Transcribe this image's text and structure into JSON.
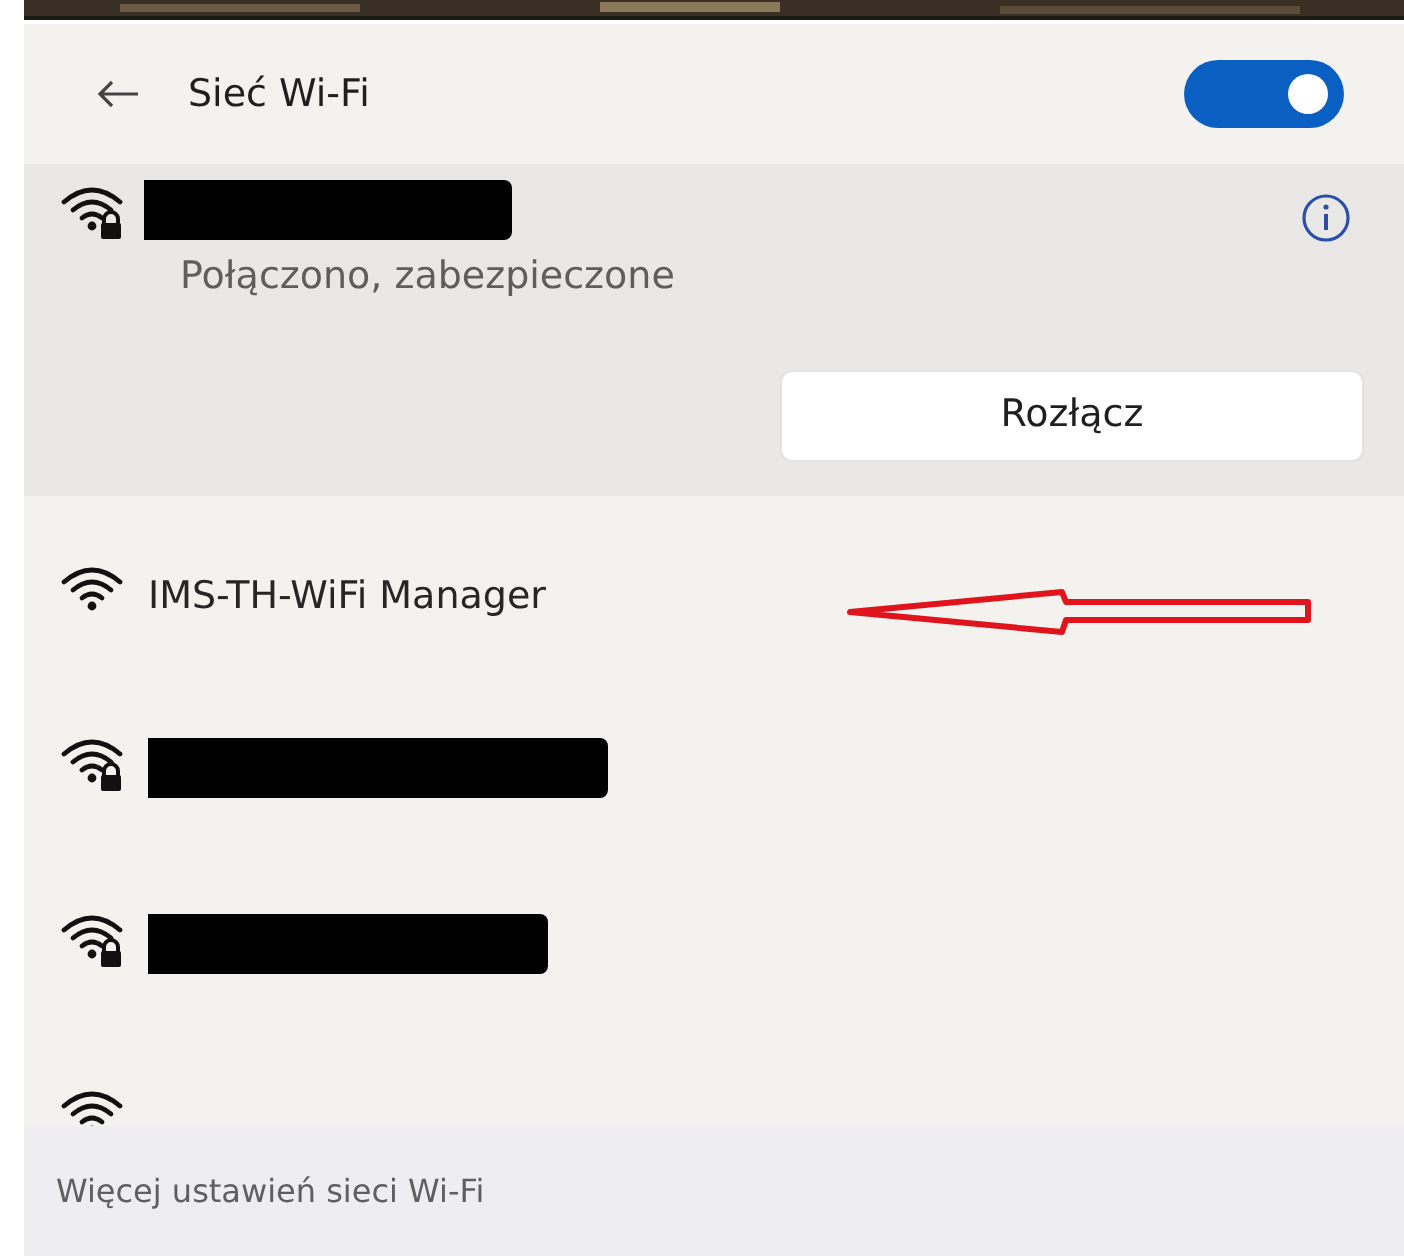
{
  "header": {
    "title": "Sieć Wi-Fi",
    "wifi_on": true
  },
  "connected": {
    "kind": "redacted",
    "status": "Połączono, zabezpieczone",
    "secured": true,
    "button": "Rozłącz"
  },
  "networks": [
    {
      "kind": "named",
      "name": "IMS-TH-WiFi Manager",
      "secured": false,
      "annotated": true
    },
    {
      "kind": "redacted",
      "secured": true,
      "annotated": false
    },
    {
      "kind": "redacted",
      "secured": true,
      "annotated": false
    },
    {
      "kind": "cut",
      "secured": false,
      "annotated": false
    }
  ],
  "footer": {
    "link": "Więcej ustawień sieci Wi-Fi"
  }
}
